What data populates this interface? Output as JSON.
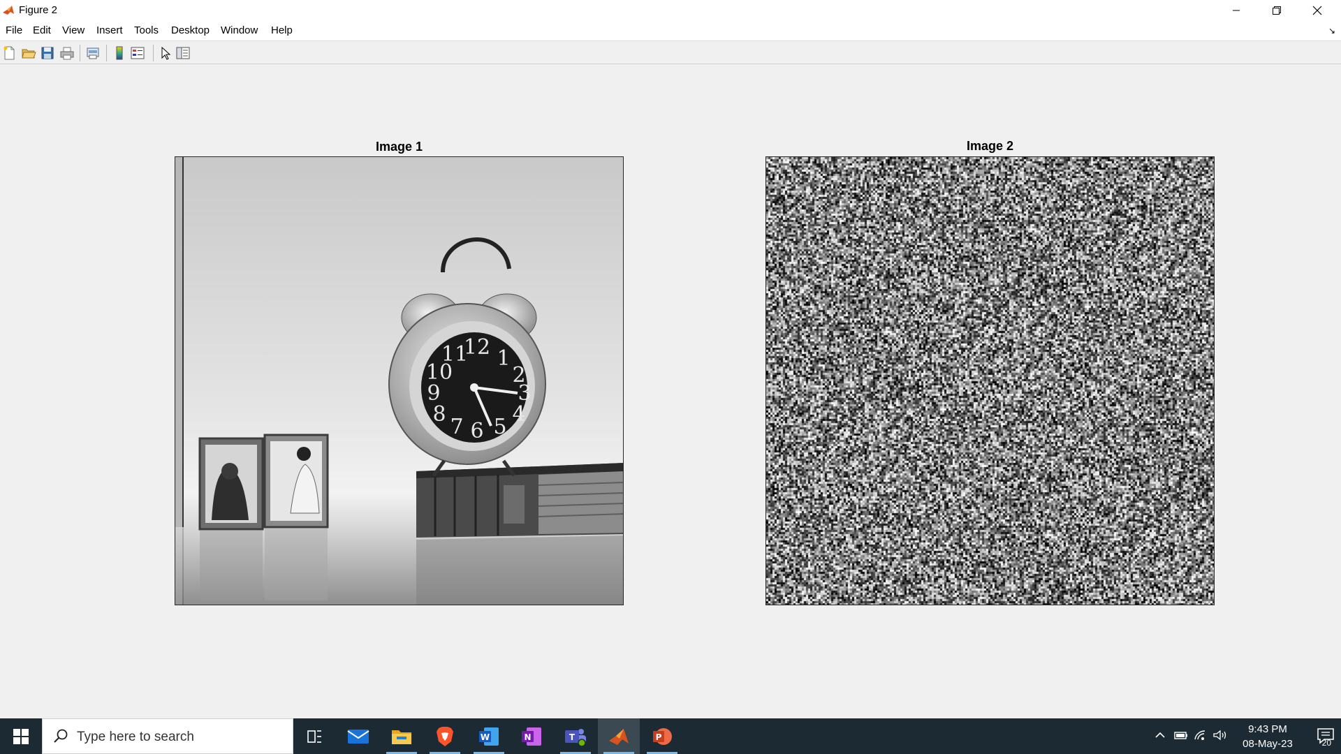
{
  "window": {
    "title": "Figure 2"
  },
  "menu": {
    "items": [
      "File",
      "Edit",
      "View",
      "Insert",
      "Tools",
      "Desktop",
      "Window",
      "Help"
    ]
  },
  "toolbar": {
    "icons": [
      "new-figure-icon",
      "open-file-icon",
      "save-icon",
      "print-icon",
      "print-preview-icon",
      "colorbar-icon",
      "legend-icon",
      "edit-plot-icon",
      "property-inspector-icon"
    ]
  },
  "figure": {
    "axes": [
      {
        "title": "Image 1",
        "content": "grayscale photo of alarm clock, book and picture frames"
      },
      {
        "title": "Image 2",
        "content": "random grayscale noise"
      }
    ]
  },
  "taskbar": {
    "search_placeholder": "Type here to search",
    "apps": [
      "task-view-icon",
      "mail-icon",
      "file-explorer-icon",
      "brave-icon",
      "word-icon",
      "onenote-icon",
      "teams-icon",
      "matlab-icon",
      "powerpoint-icon"
    ],
    "time": "9:43 PM",
    "date": "08-May-23",
    "notification_count": "20"
  },
  "colors": {
    "taskbar_bg": "#1c2b33",
    "running_indicator": "#76b9ed",
    "figure_bg": "#f0f0f0"
  }
}
